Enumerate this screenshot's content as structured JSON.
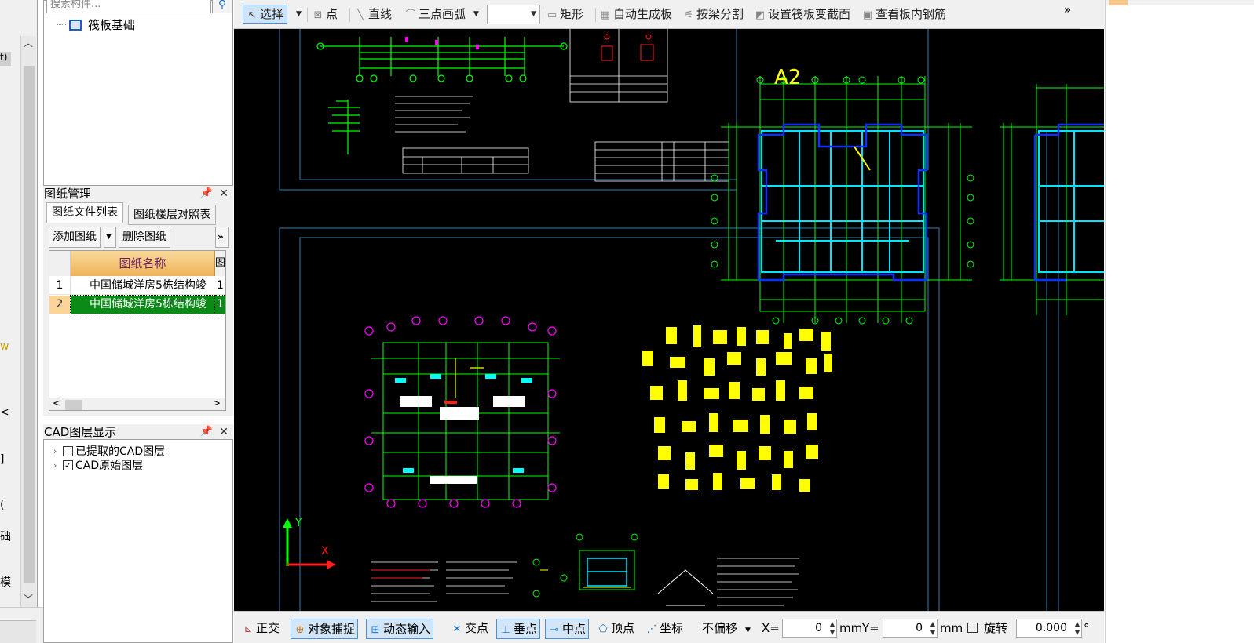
{
  "left_fragments": {
    "top_sel": "t)",
    "w": "w",
    "dot1": "<",
    "bracket": "]",
    "paren": "(",
    "base": "础",
    "model": "模"
  },
  "component_tree": {
    "search_placeholder": "搜索构件...",
    "item": "筏板基础"
  },
  "drawing_panel": {
    "title": "图纸管理",
    "tabs": [
      "图纸文件列表",
      "图纸楼层对照表"
    ],
    "add_button": "添加图纸",
    "delete_button": "删除图纸",
    "more": "»",
    "column_name": "图纸名称",
    "column_extra": "图",
    "rows": [
      {
        "index": "1",
        "name": "中国储城洋房5栋结构竣",
        "extra": "1"
      },
      {
        "index": "2",
        "name": "中国储城洋房5栋结构竣",
        "extra": "1"
      }
    ]
  },
  "layer_panel": {
    "title": "CAD图层显示",
    "items": [
      {
        "label": "已提取的CAD图层",
        "checked": false
      },
      {
        "label": "CAD原始图层",
        "checked": true
      }
    ]
  },
  "toolbar": {
    "select": "选择",
    "point": "点",
    "line": "直线",
    "arc": "三点画弧",
    "rect": "矩形",
    "auto_slab": "自动生成板",
    "split_by_beam": "按梁分割",
    "set_section": "设置筏板变截面",
    "view_rebar": "查看板内钢筋",
    "more": "»"
  },
  "canvas": {
    "sheet_label": "A2",
    "axis_y": "Y",
    "axis_x": "X",
    "colors": {
      "background": "#000000",
      "green": "#00ff00",
      "yellow": "#ffff00",
      "cyan": "#00ffff",
      "magenta": "#ff00ff",
      "white": "#ffffff",
      "blue": "#1030ff",
      "red": "#ff2020"
    }
  },
  "statusbar": {
    "ortho": "正交",
    "snap": "对象捕捉",
    "dynamic": "动态输入",
    "intersect": "交点",
    "perp": "垂点",
    "mid": "中点",
    "vertex": "顶点",
    "coord": "坐标",
    "offset": "不偏移",
    "x_label": "X=",
    "x_value": "0",
    "unit1": "mm",
    "y_label": "Y=",
    "y_value": "0",
    "unit2": "mm",
    "rotate": "旋转",
    "rotate_value": "0.000",
    "deg": "°"
  }
}
